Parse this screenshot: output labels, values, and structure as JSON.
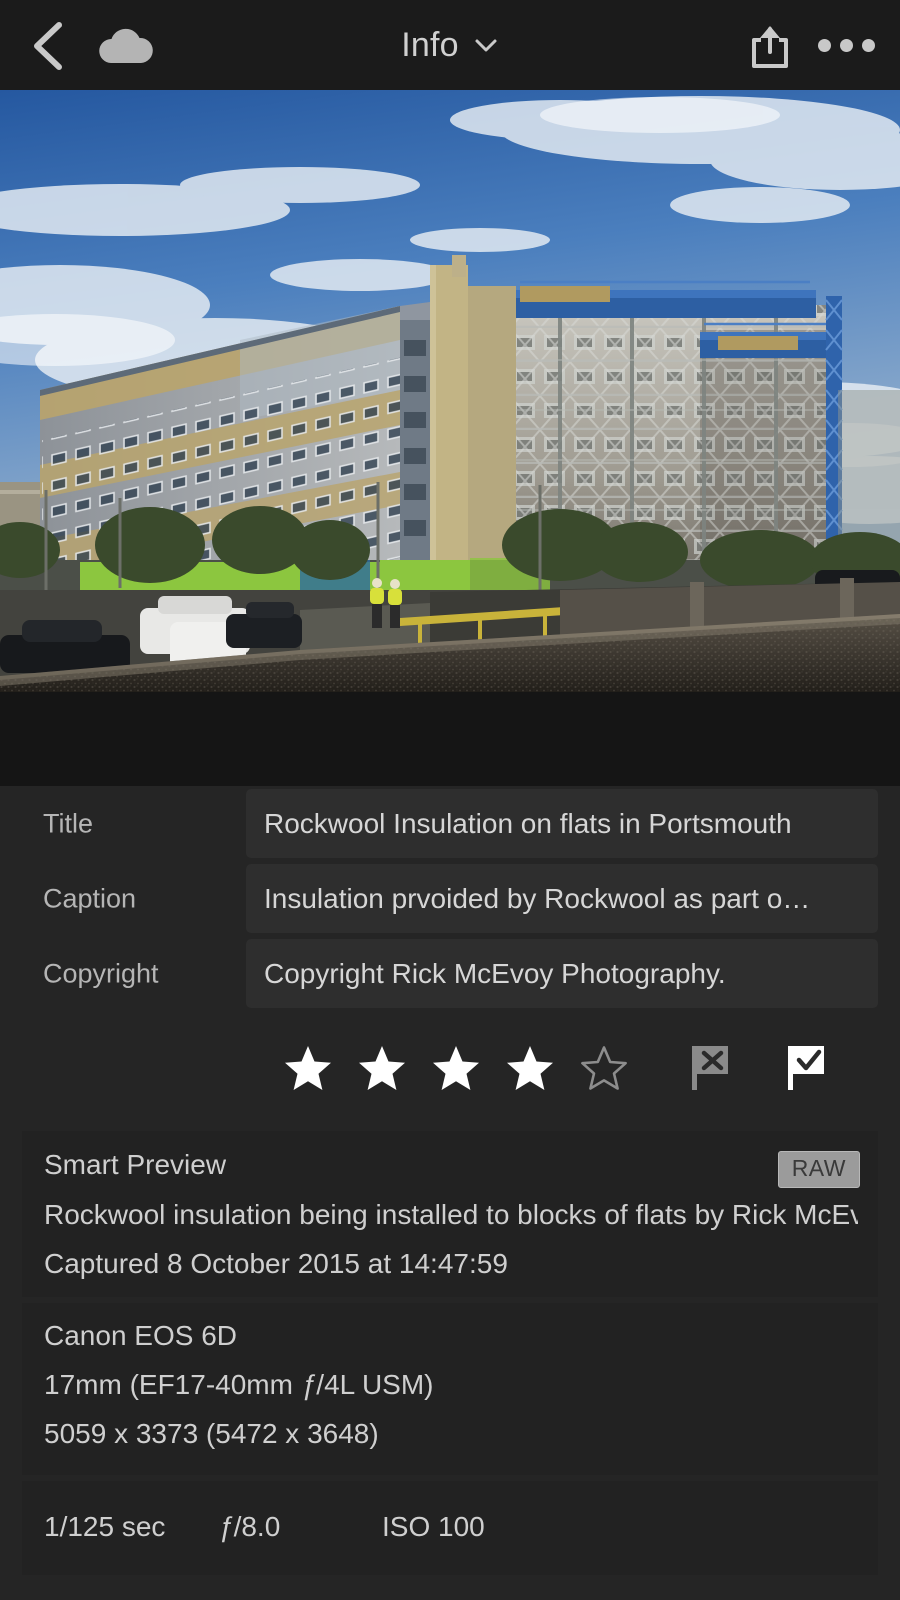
{
  "topbar": {
    "back_icon": "chevron-left-icon",
    "cloud_icon": "cloud-icon",
    "title": "Info",
    "chevron_icon": "chevron-down-icon",
    "share_icon": "share-export-icon",
    "more_icon": "more-options-icon"
  },
  "photo": {
    "alt": "Rockwool insulation being installed on tower blocks of flats in Portsmouth",
    "sky_color": "#2e62a6",
    "cloud_color": "#e9eef5",
    "building_left_grey": "#9aa0a4",
    "building_left_tan": "#b8a26c",
    "scaffold_blue": "#2f5fa8",
    "wall_color": "#514b42",
    "rail_yellow": "#c9b33a",
    "container_green": "#8cc63f"
  },
  "fields": [
    {
      "label": "Title",
      "value": "Rockwool Insulation on flats in Portsmouth"
    },
    {
      "label": "Caption",
      "value": "Insulation prvoided by Rockwool as part o…"
    },
    {
      "label": "Copyright",
      "value": "Copyright Rick McEvoy Photography."
    }
  ],
  "rating": {
    "value": 4,
    "max": 5,
    "star_filled_color": "#ffffff",
    "star_empty_color": "#8d8d8d",
    "reject_flag_icon": "flag-reject-icon",
    "pick_flag_icon": "flag-pick-icon",
    "reject_flag_active": false,
    "pick_flag_active": true
  },
  "preview_card": {
    "status": "Smart Preview",
    "badge": "RAW",
    "description": "Rockwool insulation being installed to blocks of flats by Rick McEvo…",
    "captured": "Captured 8 October 2015 at 14:47:59"
  },
  "camera_card": {
    "body": "Canon EOS 6D",
    "lens_prefix": "17mm (EF17-40mm ",
    "lens_f": "ƒ",
    "lens_suffix": "/4L USM)",
    "dimensions": "5059 x 3373 (5472 x 3648)"
  },
  "exif_card": {
    "shutter": "1/125 sec",
    "aperture_f": "ƒ",
    "aperture_value": "/8.0",
    "iso": "ISO 100"
  }
}
